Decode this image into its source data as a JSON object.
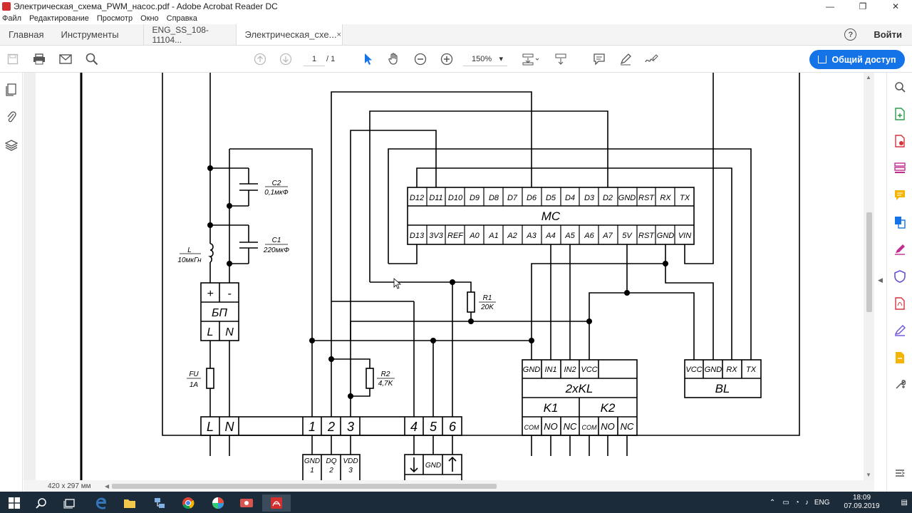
{
  "window": {
    "title": "Электрическая_схема_PWM_насос.pdf - Adobe Acrobat Reader DC",
    "minimize": "—",
    "maximize": "❐",
    "close": "✕"
  },
  "menu": [
    "Файл",
    "Редактирование",
    "Просмотр",
    "Окно",
    "Справка"
  ],
  "tabs": {
    "home": "Главная",
    "tools": "Инструменты",
    "doc1": "ENG_SS_108-11104...",
    "doc2": "Электрическая_схе...",
    "close": "×",
    "help": "?",
    "login": "Войти"
  },
  "toolbar": {
    "page_current": "1",
    "page_total": "/ 1",
    "zoom": "150%",
    "zoom_arrow": "▾",
    "share_label": "Общий доступ"
  },
  "status": {
    "page_size": "420 x 297 мм"
  },
  "taskbar": {
    "lang": "ENG",
    "time": "18:09",
    "date": "07.09.2019"
  },
  "schematic": {
    "mc_top_pins": [
      "D12",
      "D11",
      "D10",
      "D9",
      "D8",
      "D7",
      "D6",
      "D5",
      "D4",
      "D3",
      "D2",
      "GND",
      "RST",
      "RX",
      "TX"
    ],
    "mc_label": "MC",
    "mc_bottom_pins": [
      "D13",
      "3V3",
      "REF",
      "A0",
      "A1",
      "A2",
      "A3",
      "A4",
      "A5",
      "A6",
      "A7",
      "5V",
      "RST",
      "GND",
      "VIN"
    ],
    "c2_name": "C2",
    "c2_value": "0,1мкФ",
    "c1_name": "C1",
    "c1_value": "220мкФ",
    "l_name": "L",
    "l_value": "10мкГн",
    "psu_plus": "+",
    "psu_minus": "-",
    "psu_label": "БП",
    "psu_l": "L",
    "psu_n": "N",
    "fu_name": "FU",
    "fu_value": "1A",
    "r1_name": "R1",
    "r1_value": "20K",
    "r2_name": "R2",
    "r2_value": "4,7K",
    "terminals": [
      "L",
      "N",
      "1",
      "2",
      "3",
      "4",
      "5",
      "6"
    ],
    "relay_pins": [
      "GND",
      "IN1",
      "IN2",
      "VCC"
    ],
    "relay_label": "2xKL",
    "relay_k1": "K1",
    "relay_k2": "K2",
    "relay_contacts": [
      "COM",
      "NO",
      "NC",
      "COM",
      "NO",
      "NC"
    ],
    "bl_pins": [
      "VCC",
      "GND",
      "RX",
      "TX"
    ],
    "bl_label": "BL",
    "sensor_pins": [
      "GND",
      "DQ",
      "VDD"
    ],
    "sensor_nums": [
      "1",
      "2",
      "3"
    ],
    "pump_gnd": "GND"
  }
}
